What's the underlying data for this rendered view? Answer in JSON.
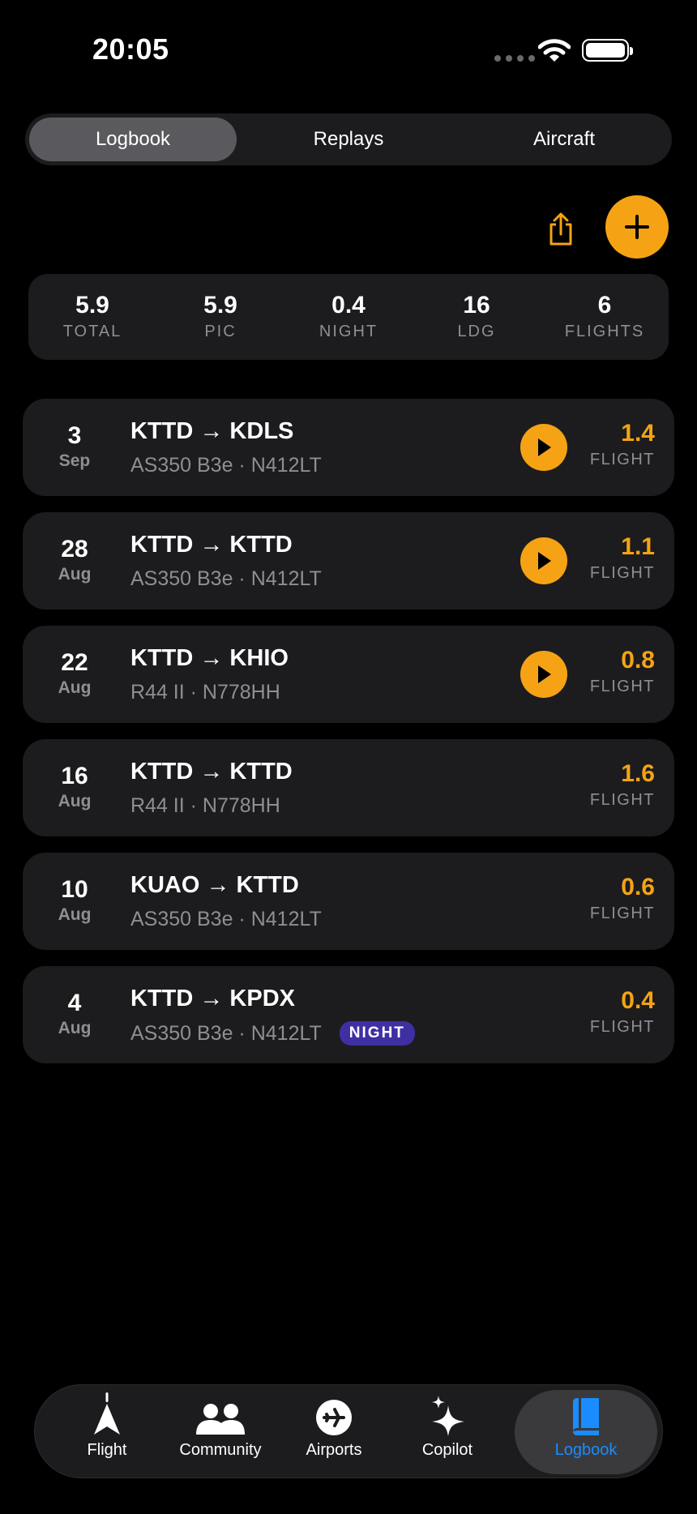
{
  "status_bar": {
    "time": "20:05"
  },
  "segments": [
    {
      "label": "Logbook",
      "active": true
    },
    {
      "label": "Replays",
      "active": false
    },
    {
      "label": "Aircraft",
      "active": false
    }
  ],
  "actions": {
    "share_icon": "share-icon",
    "add_icon": "plus-icon"
  },
  "stats": [
    {
      "value": "5.9",
      "label": "TOTAL"
    },
    {
      "value": "5.9",
      "label": "PIC"
    },
    {
      "value": "0.4",
      "label": "NIGHT"
    },
    {
      "value": "16",
      "label": "LDG"
    },
    {
      "value": "6",
      "label": "FLIGHTS"
    }
  ],
  "flights": [
    {
      "day": "3",
      "month": "Sep",
      "route": "KTTD → KDLS",
      "aircraft": "AS350 B3e · N412LT",
      "hours": "1.4",
      "hours_label": "FLIGHT",
      "replay": true,
      "badge": ""
    },
    {
      "day": "28",
      "month": "Aug",
      "route": "KTTD → KTTD",
      "aircraft": "AS350 B3e · N412LT",
      "hours": "1.1",
      "hours_label": "FLIGHT",
      "replay": true,
      "badge": ""
    },
    {
      "day": "22",
      "month": "Aug",
      "route": "KTTD → KHIO",
      "aircraft": "R44 II · N778HH",
      "hours": "0.8",
      "hours_label": "FLIGHT",
      "replay": true,
      "badge": ""
    },
    {
      "day": "16",
      "month": "Aug",
      "route": "KTTD → KTTD",
      "aircraft": "R44 II · N778HH",
      "hours": "1.6",
      "hours_label": "FLIGHT",
      "replay": false,
      "badge": ""
    },
    {
      "day": "10",
      "month": "Aug",
      "route": "KUAO → KTTD",
      "aircraft": "AS350 B3e · N412LT",
      "hours": "0.6",
      "hours_label": "FLIGHT",
      "replay": false,
      "badge": ""
    },
    {
      "day": "4",
      "month": "Aug",
      "route": "KTTD → KPDX",
      "aircraft": "AS350 B3e · N412LT",
      "hours": "0.4",
      "hours_label": "FLIGHT",
      "replay": false,
      "badge": "NIGHT"
    }
  ],
  "tabs": [
    {
      "label": "Flight",
      "icon": "navigation-arrow-icon",
      "active": false
    },
    {
      "label": "Community",
      "icon": "people-icon",
      "active": false
    },
    {
      "label": "Airports",
      "icon": "airplane-circle-icon",
      "active": false
    },
    {
      "label": "Copilot",
      "icon": "sparkles-icon",
      "active": false
    },
    {
      "label": "Logbook",
      "icon": "book-icon",
      "active": true
    }
  ],
  "colors": {
    "accent": "#f5a314",
    "tab_active": "#1a8cff",
    "night_badge": "#3e2fa3",
    "card": "#1c1c1e"
  }
}
